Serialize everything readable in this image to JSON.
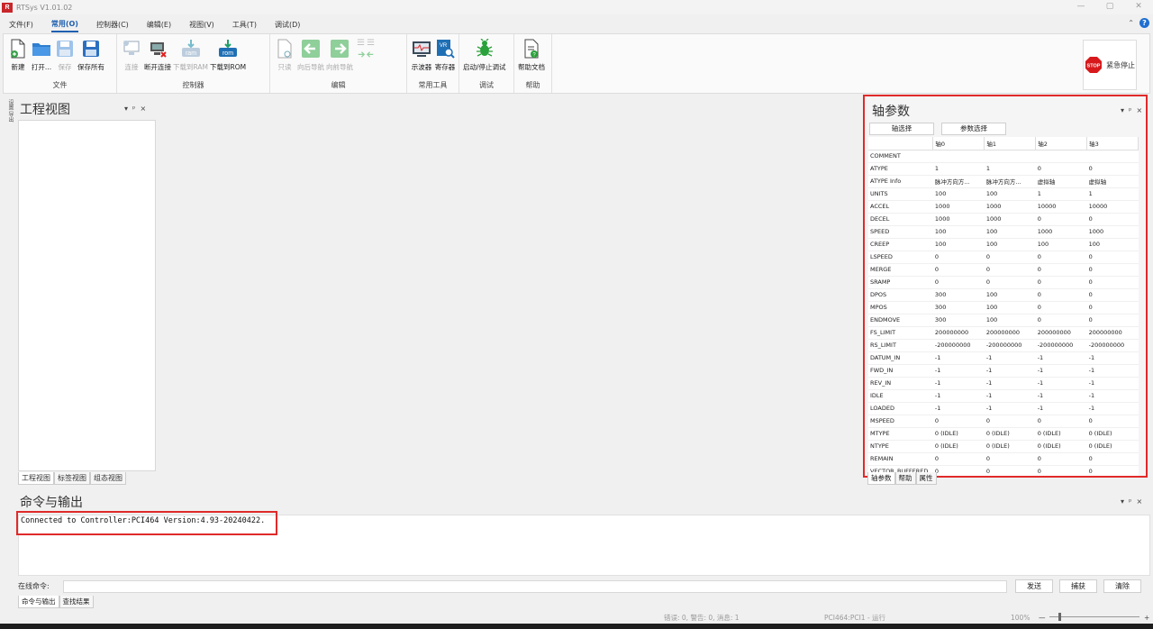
{
  "window": {
    "title": "RTSys V1.01.02",
    "logo_text": "R",
    "controls": [
      "—",
      "▢",
      "✕"
    ]
  },
  "menu": {
    "items": [
      "文件(F)",
      "常用(O)",
      "控制器(C)",
      "编辑(E)",
      "视图(V)",
      "工具(T)",
      "调试(D)"
    ],
    "active_index": 1,
    "help_icon": "?"
  },
  "ribbon": {
    "groups": [
      {
        "name": "文件",
        "buttons": [
          {
            "label": "新建",
            "icon": "new-file-icon",
            "enabled": true
          },
          {
            "label": "打开...",
            "icon": "folder-icon",
            "enabled": true
          },
          {
            "label": "保存",
            "icon": "save-icon",
            "enabled": false
          },
          {
            "label": "保存所有",
            "icon": "save-all-icon",
            "enabled": true
          }
        ]
      },
      {
        "name": "控制器",
        "buttons": [
          {
            "label": "连接",
            "icon": "connect-icon",
            "enabled": false
          },
          {
            "label": "断开连接",
            "icon": "disconnect-icon",
            "enabled": true
          },
          {
            "label": "下载到RAM",
            "icon": "ram-icon",
            "enabled": false
          },
          {
            "label": "下载到ROM",
            "icon": "rom-icon",
            "enabled": true
          }
        ]
      },
      {
        "name": "编辑",
        "buttons": [
          {
            "label": "只读",
            "icon": "readonly-icon",
            "enabled": false
          },
          {
            "label": "向后导航",
            "icon": "arrow-left-icon",
            "enabled": false
          },
          {
            "label": "向前导航",
            "icon": "arrow-right-icon",
            "enabled": false
          },
          {
            "label": "",
            "icon": "indent-icon",
            "enabled": false
          }
        ]
      },
      {
        "name": "常用工具",
        "buttons": [
          {
            "label": "示波器",
            "icon": "oscilloscope-icon",
            "enabled": true
          },
          {
            "label": "寄存器",
            "icon": "register-icon",
            "enabled": true
          }
        ]
      },
      {
        "name": "调试",
        "buttons": [
          {
            "label": "启动/停止调试",
            "icon": "bug-icon",
            "enabled": true
          }
        ]
      },
      {
        "name": "帮助",
        "buttons": [
          {
            "label": "帮助文档",
            "icon": "help-doc-icon",
            "enabled": true
          }
        ]
      }
    ],
    "stop": {
      "label": "紧急停止",
      "icon_text": "STOP"
    }
  },
  "left_strip": "设置 导出",
  "project": {
    "title": "工程视图",
    "panel_controls": [
      "▾",
      "ᵖ",
      "×"
    ],
    "tabs": [
      "工程视图",
      "标签视图",
      "组态视图"
    ]
  },
  "axis": {
    "title": "轴参数",
    "panel_controls": [
      "▾",
      "ᵖ",
      "×"
    ],
    "btn_axis": "轴选择",
    "btn_param": "参数选择",
    "columns": [
      "",
      "轴0",
      "轴1",
      "轴2",
      "轴3"
    ],
    "rows": [
      [
        "COMMENT",
        "",
        "",
        "",
        ""
      ],
      [
        "ATYPE",
        "1",
        "1",
        "0",
        "0"
      ],
      [
        "ATYPE Info",
        "脉冲方向方...",
        "脉冲方向方...",
        "虚拟轴",
        "虚拟轴"
      ],
      [
        "UNITS",
        "100",
        "100",
        "1",
        "1"
      ],
      [
        "ACCEL",
        "1000",
        "1000",
        "10000",
        "10000"
      ],
      [
        "DECEL",
        "1000",
        "1000",
        "0",
        "0"
      ],
      [
        "SPEED",
        "100",
        "100",
        "1000",
        "1000"
      ],
      [
        "CREEP",
        "100",
        "100",
        "100",
        "100"
      ],
      [
        "LSPEED",
        "0",
        "0",
        "0",
        "0"
      ],
      [
        "MERGE",
        "0",
        "0",
        "0",
        "0"
      ],
      [
        "SRAMP",
        "0",
        "0",
        "0",
        "0"
      ],
      [
        "DPOS",
        "300",
        "100",
        "0",
        "0"
      ],
      [
        "MPOS",
        "300",
        "100",
        "0",
        "0"
      ],
      [
        "ENDMOVE",
        "300",
        "100",
        "0",
        "0"
      ],
      [
        "FS_LIMIT",
        "200000000",
        "200000000",
        "200000000",
        "200000000"
      ],
      [
        "RS_LIMIT",
        "-200000000",
        "-200000000",
        "-200000000",
        "-200000000"
      ],
      [
        "DATUM_IN",
        "-1",
        "-1",
        "-1",
        "-1"
      ],
      [
        "FWD_IN",
        "-1",
        "-1",
        "-1",
        "-1"
      ],
      [
        "REV_IN",
        "-1",
        "-1",
        "-1",
        "-1"
      ],
      [
        "IDLE",
        "-1",
        "-1",
        "-1",
        "-1"
      ],
      [
        "LOADED",
        "-1",
        "-1",
        "-1",
        "-1"
      ],
      [
        "MSPEED",
        "0",
        "0",
        "0",
        "0"
      ],
      [
        "MTYPE",
        "0 (IDLE)",
        "0 (IDLE)",
        "0 (IDLE)",
        "0 (IDLE)"
      ],
      [
        "NTYPE",
        "0 (IDLE)",
        "0 (IDLE)",
        "0 (IDLE)",
        "0 (IDLE)"
      ],
      [
        "REMAIN",
        "0",
        "0",
        "0",
        "0"
      ],
      [
        "VECTOR_BUFFERED",
        "0",
        "0",
        "0",
        "0"
      ]
    ],
    "tabs": [
      "轴参数",
      "帮助",
      "属性"
    ]
  },
  "command": {
    "title": "命令与输出",
    "panel_controls": [
      "▾",
      "ᵖ",
      "×"
    ],
    "message": "Connected to Controller:PCI464 Version:4.93-20240422.",
    "online_label": "在线命令:",
    "btn_send": "发送",
    "btn_capture": "捕获",
    "btn_clear": "清除",
    "tabs": [
      "命令与输出",
      "查找结果"
    ]
  },
  "status": {
    "messages": "错误: 0, 警告: 0, 消息: 1",
    "controller": "PCI464:PCI1 - 运行",
    "zoom": "100%",
    "zoom_level": 1.0
  }
}
